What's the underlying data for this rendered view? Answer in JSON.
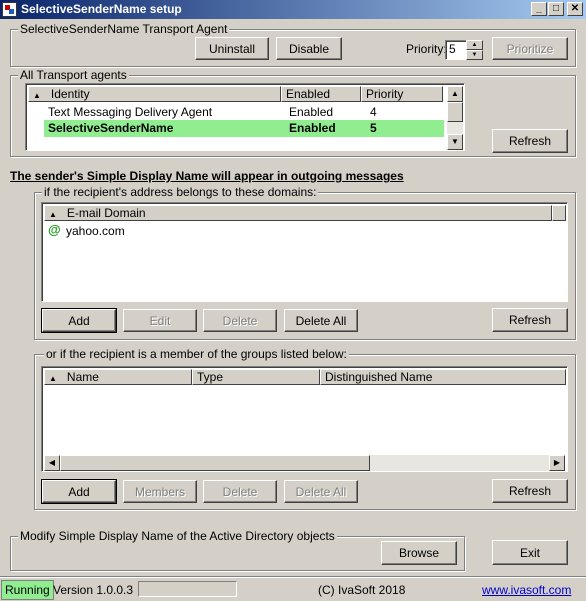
{
  "window": {
    "title": "SelectiveSenderName setup",
    "minimize_glyph": "_",
    "maximize_glyph": "□",
    "close_glyph": "✕"
  },
  "transport_agent": {
    "group_label": "SelectiveSenderName Transport Agent",
    "uninstall_label": "Uninstall",
    "disable_label": "Disable",
    "priority_label": "Priority:",
    "priority_value": "5",
    "prioritize_label": "Prioritize"
  },
  "all_agents": {
    "group_label": "All Transport agents",
    "columns": [
      "Identity",
      "Enabled",
      "Priority"
    ],
    "rows": [
      {
        "identity": "Text Messaging Delivery Agent",
        "enabled": "Enabled",
        "priority": "4"
      },
      {
        "identity": "SelectiveSenderName",
        "enabled": "Enabled",
        "priority": "5"
      }
    ],
    "refresh_label": "Refresh"
  },
  "heading": "The sender's Simple Display Name will appear in outgoing messages",
  "domains": {
    "group_label": "if the recipient's address belongs to these domains:",
    "column": "E-mail Domain",
    "items": [
      "yahoo.com"
    ],
    "item_icon": "at-sign-icon",
    "add_label": "Add",
    "edit_label": "Edit",
    "delete_label": "Delete",
    "delete_all_label": "Delete All",
    "refresh_label": "Refresh"
  },
  "groups": {
    "group_label": "or if the recipient is a member of the groups listed below:",
    "columns": [
      "Name",
      "Type",
      "Distinguished Name"
    ],
    "add_label": "Add",
    "members_label": "Members",
    "delete_label": "Delete",
    "delete_all_label": "Delete All",
    "refresh_label": "Refresh"
  },
  "modify": {
    "group_label": "Modify Simple Display Name of the Active Directory objects",
    "browse_label": "Browse",
    "exit_label": "Exit"
  },
  "status": {
    "state": "Running",
    "state_color": "#90ee90",
    "version": "Version 1.0.0.3",
    "copyright": "(C) IvaSoft 2018",
    "website": "www.ivasoft.com"
  },
  "colors": {
    "selected_row": "#90ee90",
    "title_gradient_start": "#0a246a",
    "title_gradient_end": "#a6caf0",
    "link": "#0000cc"
  }
}
